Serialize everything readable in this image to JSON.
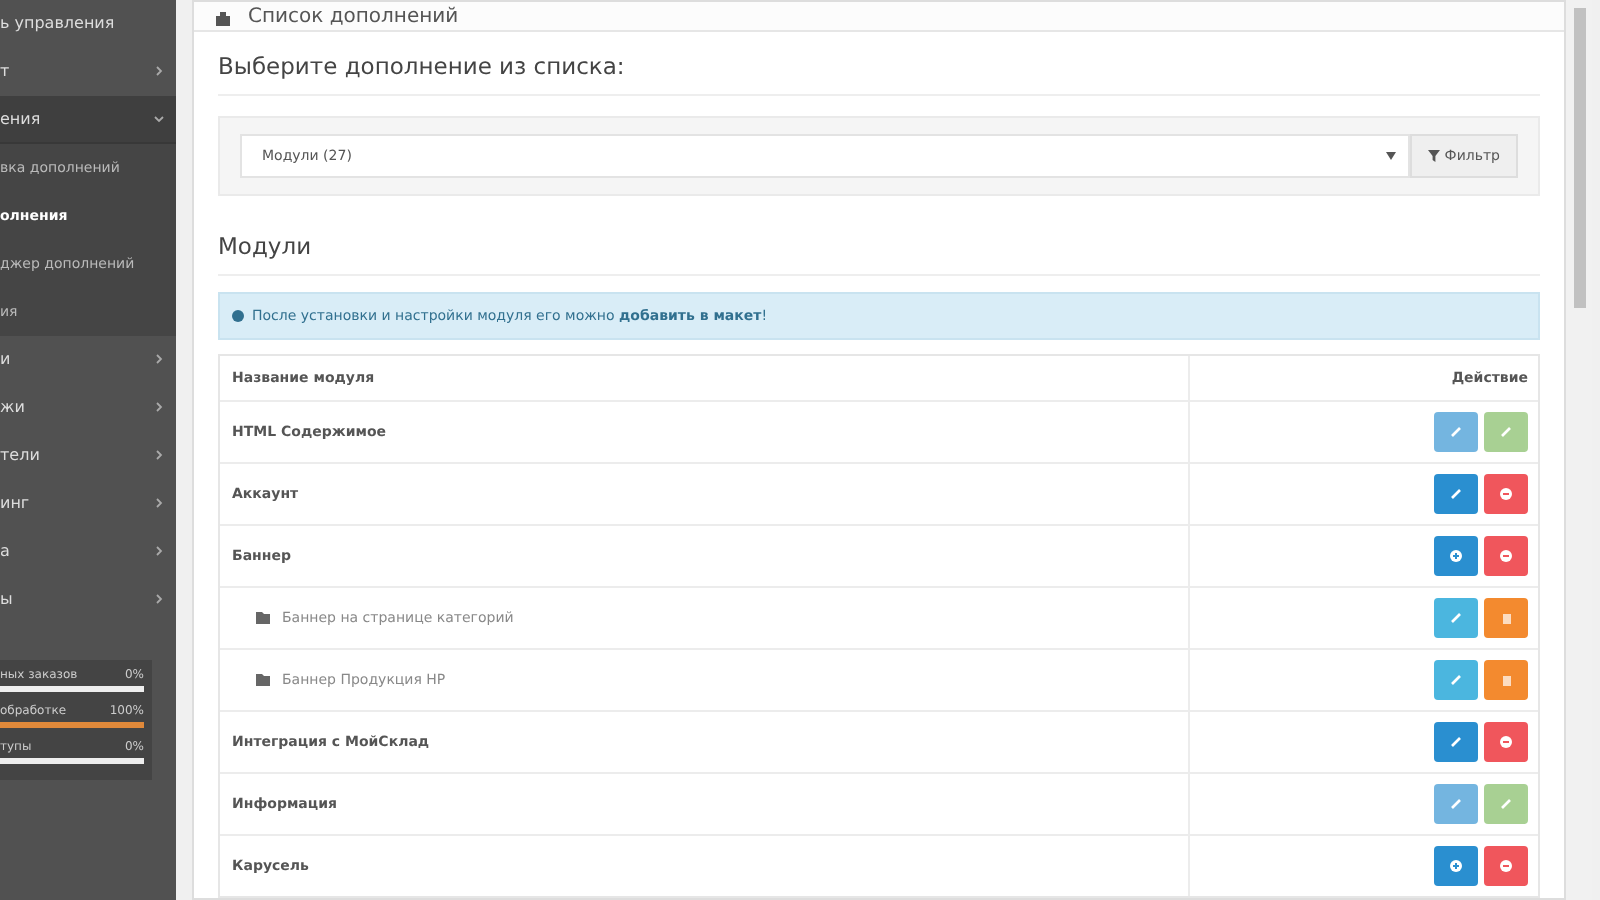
{
  "sidebar": {
    "items": [
      {
        "label": "ь управления",
        "expanded": false,
        "selected": false,
        "arrow": false
      },
      {
        "label": "т",
        "expanded": false,
        "selected": false,
        "arrow": true
      },
      {
        "label": "ения",
        "expanded": true,
        "selected": true,
        "arrow": true,
        "children": [
          {
            "label": "вка дополнений",
            "selected": false
          },
          {
            "label": "олнения",
            "selected": true
          },
          {
            "label": "джер дополнений",
            "selected": false
          },
          {
            "label": "ия",
            "selected": false
          }
        ]
      },
      {
        "label": "и",
        "expanded": false,
        "selected": false,
        "arrow": true
      },
      {
        "label": "жи",
        "expanded": false,
        "selected": false,
        "arrow": true
      },
      {
        "label": "тели",
        "expanded": false,
        "selected": false,
        "arrow": true
      },
      {
        "label": "инг",
        "expanded": false,
        "selected": false,
        "arrow": true
      },
      {
        "label": "а",
        "expanded": false,
        "selected": false,
        "arrow": true
      },
      {
        "label": "ы",
        "expanded": false,
        "selected": false,
        "arrow": true
      }
    ],
    "stats": [
      {
        "label": "ных заказов",
        "value": "0%",
        "level": 0
      },
      {
        "label": "обработке",
        "value": "100%",
        "level": 1
      },
      {
        "label": "тупы",
        "value": "0%",
        "level": 0
      }
    ]
  },
  "panel": {
    "title": "Список дополнений",
    "heading": "Выберите дополнение из списка:",
    "select": {
      "value": "Модули (27)"
    },
    "filter_button": "Фильтр",
    "section_title": "Модули",
    "alert": "После установки и настройки модуля его можно **добавить в макет**!",
    "table": {
      "columns": [
        "Название модуля",
        "Действие"
      ],
      "rows": [
        {
          "name": "HTML Содержимое",
          "child": false,
          "actions": [
            {
              "kind": "edit",
              "disabled": true
            },
            {
              "kind": "install",
              "disabled": true
            }
          ]
        },
        {
          "name": "Аккаунт",
          "child": false,
          "actions": [
            {
              "kind": "edit",
              "disabled": false
            },
            {
              "kind": "uninstall",
              "disabled": false
            }
          ]
        },
        {
          "name": "Баннер",
          "child": false,
          "actions": [
            {
              "kind": "add",
              "disabled": false
            },
            {
              "kind": "uninstall",
              "disabled": false
            }
          ]
        },
        {
          "name": "Баннер на странице категорий",
          "child": true,
          "actions": [
            {
              "kind": "edit_module",
              "disabled": false
            },
            {
              "kind": "delete",
              "disabled": false
            }
          ]
        },
        {
          "name": "Баннер Продукция HP",
          "child": true,
          "actions": [
            {
              "kind": "edit_module",
              "disabled": false
            },
            {
              "kind": "delete",
              "disabled": false
            }
          ]
        },
        {
          "name": "Интеграция с МойСклад",
          "child": false,
          "actions": [
            {
              "kind": "edit",
              "disabled": false
            },
            {
              "kind": "uninstall",
              "disabled": false
            }
          ]
        },
        {
          "name": "Информация",
          "child": false,
          "actions": [
            {
              "kind": "edit",
              "disabled": true
            },
            {
              "kind": "install",
              "disabled": true
            }
          ]
        },
        {
          "name": "Карусель",
          "child": false,
          "actions": [
            {
              "kind": "add",
              "disabled": false
            },
            {
              "kind": "uninstall",
              "disabled": false
            }
          ]
        }
      ]
    }
  }
}
